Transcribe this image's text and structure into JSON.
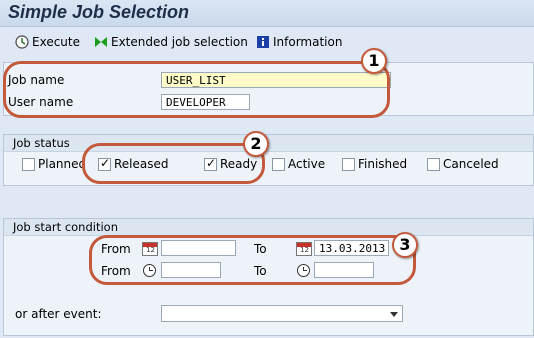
{
  "title": "Simple Job Selection",
  "toolbar": {
    "execute": "Execute",
    "extended": "Extended job selection",
    "information": "Information"
  },
  "job_fields": {
    "job_name_label": "Job name",
    "job_name_value": "USER_LIST",
    "user_name_label": "User name",
    "user_name_value": "DEVELOPER"
  },
  "job_status": {
    "title": "Job status",
    "options": [
      {
        "label": "Planned",
        "checked": false
      },
      {
        "label": "Released",
        "checked": true
      },
      {
        "label": "Ready",
        "checked": true
      },
      {
        "label": "Active",
        "checked": false
      },
      {
        "label": "Finished",
        "checked": false
      },
      {
        "label": "Canceled",
        "checked": false
      }
    ]
  },
  "start_condition": {
    "title": "Job start condition",
    "from_label": "From",
    "to_label": "To",
    "from_date": "",
    "to_date": "13.03.2013",
    "from_time": "",
    "to_time": "",
    "after_event_label": "or after event:",
    "after_event_value": ""
  },
  "callouts": [
    "1",
    "2",
    "3"
  ],
  "colors": {
    "callout": "#c45a3c",
    "required_field": "#fffbc8",
    "background": "#dfe9f5"
  }
}
